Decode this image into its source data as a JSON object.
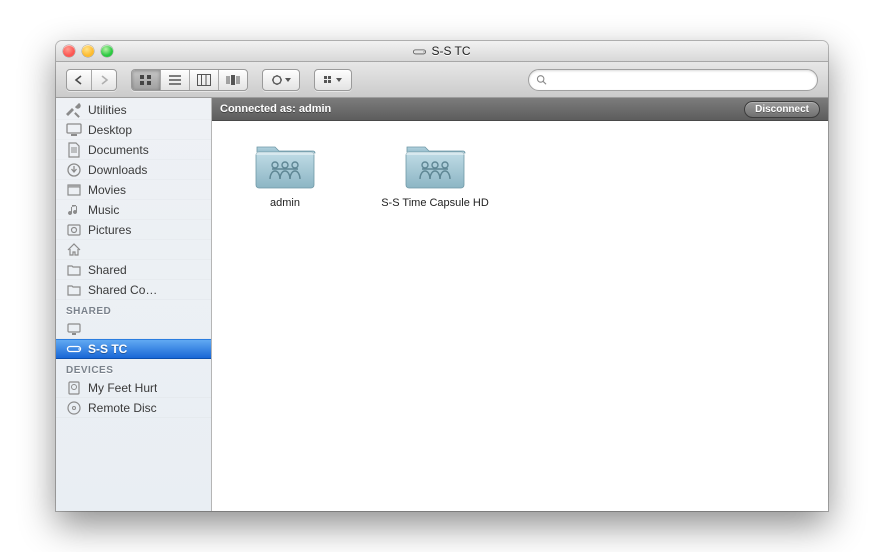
{
  "window": {
    "title": "S-S TC"
  },
  "toolbar": {},
  "search": {
    "placeholder": ""
  },
  "sidebar": {
    "favorites": [
      {
        "icon": "utilities",
        "label": "Utilities"
      },
      {
        "icon": "desktop",
        "label": "Desktop"
      },
      {
        "icon": "documents",
        "label": "Documents"
      },
      {
        "icon": "downloads",
        "label": "Downloads"
      },
      {
        "icon": "movies",
        "label": "Movies"
      },
      {
        "icon": "music",
        "label": "Music"
      },
      {
        "icon": "pictures",
        "label": "Pictures"
      },
      {
        "icon": "home",
        "label": ""
      },
      {
        "icon": "folder",
        "label": "Shared"
      },
      {
        "icon": "folder",
        "label": "Shared Co…"
      }
    ],
    "shared_header": "SHARED",
    "shared": [
      {
        "icon": "computer",
        "label": "",
        "selected": false
      },
      {
        "icon": "timecapsule",
        "label": "S-S TC",
        "selected": true
      }
    ],
    "devices_header": "DEVICES",
    "devices": [
      {
        "icon": "disk",
        "label": "My Feet Hurt"
      },
      {
        "icon": "disc",
        "label": "Remote Disc"
      }
    ]
  },
  "banner": {
    "connected_prefix": "Connected as: ",
    "connected_user": "admin",
    "disconnect_label": "Disconnect"
  },
  "content": {
    "items": [
      {
        "label": "admin"
      },
      {
        "label": "S-S Time Capsule HD"
      }
    ]
  }
}
